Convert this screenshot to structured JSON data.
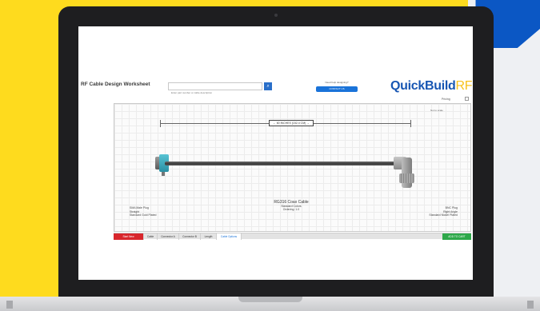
{
  "app": {
    "title": "RF Cable Design Worksheet",
    "search_placeholder": "Enter part number or cable description",
    "search_icon": "search-icon",
    "help_label": "Need help designing?",
    "help_button": "CONTACT US",
    "logo_main": "QuickBuild",
    "logo_suffix": "RF",
    "pricing_label": "Pricing",
    "scale_label": "Not to scale"
  },
  "drawing": {
    "length_label": "← 60 INCHES (152.4 CM) →",
    "left_info": [
      "SMA Male Plug",
      "Straight",
      "Standard Gold Plated"
    ],
    "center_info": [
      "RG316 Coax Cable",
      "Standard Colors",
      "Ordering: 1.0"
    ],
    "right_info": [
      "BNC Plug",
      "Right Angle",
      "Standard Nickel Plated"
    ]
  },
  "tabs": [
    "Start New",
    "Cable",
    "Connector A",
    "Connector B",
    "Length",
    "Cable Options"
  ],
  "add_to_cart": "ADD TO CART",
  "colors": {
    "accent_blue": "#1756b3",
    "logo_rf_yellow": "#f8c21c",
    "start_red": "#d8262c",
    "cart_green": "#2ea84a",
    "connector_teal": "#3aa9bb",
    "background_yellow": "#fedb1e"
  }
}
